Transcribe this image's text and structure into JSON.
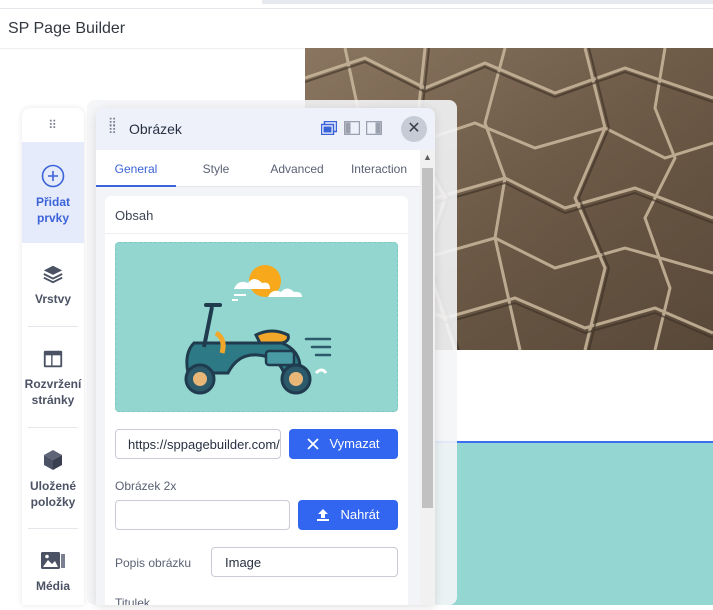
{
  "app": {
    "title": "SP Page Builder"
  },
  "sidebar": {
    "items": [
      {
        "label": "Přidat prvky",
        "icon": "plus-circle-icon",
        "active": true
      },
      {
        "label": "Vrstvy",
        "icon": "layers-icon"
      },
      {
        "label": "Rozvržení stránky",
        "icon": "layout-icon"
      },
      {
        "label": "Uložené položky",
        "icon": "cube-icon"
      },
      {
        "label": "Média",
        "icon": "media-icon"
      }
    ]
  },
  "panel": {
    "title": "Obrázek",
    "tabs": [
      {
        "label": "General",
        "active": true
      },
      {
        "label": "Style"
      },
      {
        "label": "Advanced"
      },
      {
        "label": "Interaction"
      }
    ],
    "section": {
      "title": "Obsah"
    },
    "image_url": "https://sppagebuilder.com/",
    "clear_label": "Vymazat",
    "image2x_label": "Obrázek 2x",
    "upload_label": "Nahrát",
    "alt_label": "Popis obrázku",
    "alt_value": "Image",
    "next_label": "Titulek"
  },
  "colors": {
    "accent": "#3366f0",
    "teal": "#92d6cf"
  }
}
